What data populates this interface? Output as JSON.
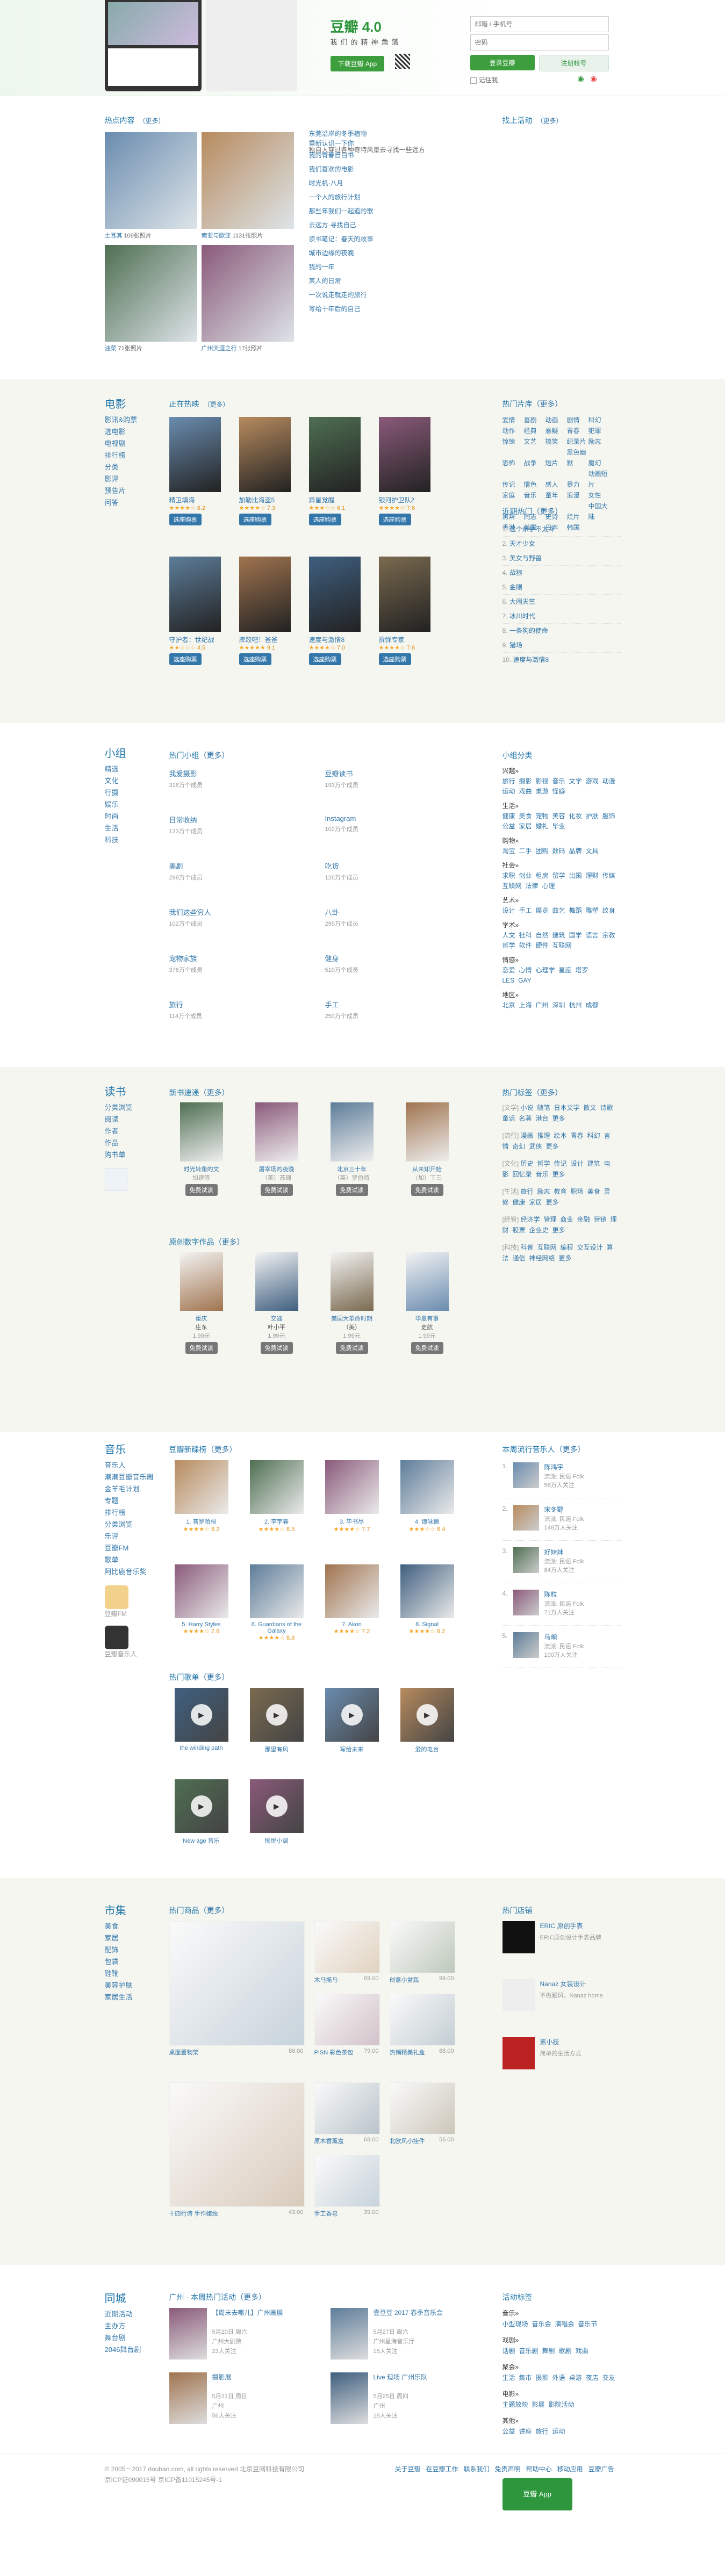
{
  "top": {
    "brand": "豆瓣 4.0",
    "tagline": "我们的精神角落",
    "download_btn": "下载豆瓣 App",
    "username_placeholder": "邮箱 / 手机号",
    "password_placeholder": "密码",
    "login_btn": "登录豆瓣",
    "register_btn": "注册帐号",
    "remember": "记住我",
    "forgot": "忘记密码"
  },
  "hot": {
    "title": "热点内容",
    "more": "（更多）",
    "photos": [
      {
        "caption": "土耳其",
        "count": "108张照片"
      },
      {
        "caption": "南亚与欧亚",
        "count": "1131张照片"
      },
      {
        "caption": "油菜",
        "count": "71张照片"
      },
      {
        "caption": "广州天涯之行",
        "count": "17张照片"
      }
    ],
    "articles": [
      "东莞沿岸的冬季植物",
      "重新认识一下你",
      "我的青春自白书",
      "我们喜欢的电影",
      "时光机·八月",
      "一个人的旅行计划",
      "那些年我们一起追的歌",
      "去远方·寻找自己",
      "读书笔记：春天的故事",
      "城市边缘的夜晚",
      "我的一年",
      "某人的日常",
      "一次说走就走的旅行",
      "写给十年后的自己"
    ],
    "intro": "独自人穿过各种奇特风景去寻找一些远方",
    "right_title": "找上活动",
    "right_more": "（更多）"
  },
  "movie": {
    "title": "电影",
    "nav": [
      "影讯&购票",
      "选电影",
      "电视剧",
      "排行榜",
      "分类",
      "影评",
      "预告片",
      "问答"
    ],
    "now_playing": "正在热映",
    "more": "（更多）",
    "buy_btn": "选座购票",
    "row1": [
      {
        "name": "精卫填海",
        "score": "8.2"
      },
      {
        "name": "加勒比海盗5",
        "score": "7.3"
      },
      {
        "name": "异星觉醒",
        "score": "6.1"
      },
      {
        "name": "银河护卫队2",
        "score": "7.6"
      }
    ],
    "row2": [
      {
        "name": "守护者：世纪战",
        "score": "4.5"
      },
      {
        "name": "摔跤吧！爸爸",
        "score": "9.1"
      },
      {
        "name": "速度与激情8",
        "score": "7.0"
      },
      {
        "name": "拆弹专家",
        "score": "7.8"
      }
    ],
    "tags_title": "热门片库",
    "tags_more": "（更多）",
    "tags": [
      "爱情",
      "喜剧",
      "动画",
      "剧情",
      "科幻",
      "动作",
      "经典",
      "悬疑",
      "青春",
      "犯罪",
      "惊悚",
      "文艺",
      "搞笑",
      "纪录片",
      "励志",
      "恐怖",
      "战争",
      "短片",
      "黑色幽默",
      "魔幻",
      "传记",
      "情色",
      "感人",
      "暴力",
      "动画短片",
      "家庭",
      "音乐",
      "童年",
      "浪漫",
      "女性",
      "黑帮",
      "同志",
      "史诗",
      "烂片",
      "中国大陆",
      "香港",
      "美国",
      "日本",
      "韩国"
    ],
    "rank_title": "近期热门",
    "rank_more": "（更多）",
    "rank": [
      "这个杀手不太冷",
      "天才少女",
      "美女与野兽",
      "战狼",
      "金刚",
      "大闹天竺",
      "冰川时代",
      "一条狗的使命",
      "猎场",
      "速度与激情8"
    ]
  },
  "group": {
    "title": "小组",
    "nav": [
      "精选",
      "文化",
      "行摄",
      "娱乐",
      "时尚",
      "生活",
      "科技"
    ],
    "hot_title": "热门小组",
    "more": "（更多）",
    "items": [
      {
        "name": "我爱摄影",
        "count": "316万个成员"
      },
      {
        "name": "豆瓣读书",
        "count": "193万个成员"
      },
      {
        "name": "日常收纳",
        "count": "123万个成员"
      },
      {
        "name": "Instagram",
        "count": "102万个成员"
      },
      {
        "name": "美剧",
        "count": "298万个成员"
      },
      {
        "name": "吃货",
        "count": "126万个成员"
      },
      {
        "name": "我们这些穷人",
        "count": "102万个成员"
      },
      {
        "name": "八卦",
        "count": "295万个成员"
      },
      {
        "name": "宠物家族",
        "count": "376万个成员"
      },
      {
        "name": "健身",
        "count": "510万个成员"
      },
      {
        "name": "旅行",
        "count": "114万个成员"
      },
      {
        "name": "手工",
        "count": "250万个成员"
      }
    ],
    "cat_title": "小组分类",
    "cats": [
      {
        "title": "兴趣»",
        "tags": [
          "旅行",
          "摄影",
          "影视",
          "音乐",
          "文学",
          "游戏",
          "动漫",
          "运动",
          "戏曲",
          "桌游",
          "怪癖"
        ]
      },
      {
        "title": "生活»",
        "tags": [
          "健康",
          "美食",
          "宠物",
          "美容",
          "化妆",
          "护肤",
          "服饰",
          "公益",
          "家居",
          "婚礼",
          "毕业"
        ]
      },
      {
        "title": "购物»",
        "tags": [
          "淘宝",
          "二手",
          "团购",
          "数码",
          "品牌",
          "文具"
        ]
      },
      {
        "title": "社会»",
        "tags": [
          "求职",
          "创业",
          "租房",
          "留学",
          "出国",
          "理财",
          "传媒",
          "互联网",
          "法律",
          "心理"
        ]
      },
      {
        "title": "艺术»",
        "tags": [
          "设计",
          "手工",
          "展览",
          "曲艺",
          "舞蹈",
          "雕塑",
          "纹身"
        ]
      },
      {
        "title": "学术»",
        "tags": [
          "人文",
          "社科",
          "自然",
          "建筑",
          "国学",
          "语言",
          "宗教",
          "哲学",
          "软件",
          "硬件",
          "互联网"
        ]
      },
      {
        "title": "情感»",
        "tags": [
          "恋爱",
          "心情",
          "心理学",
          "星座",
          "塔罗",
          "LES",
          "GAY"
        ]
      },
      {
        "title": "地区»",
        "tags": [
          "北京",
          "上海",
          "广州",
          "深圳",
          "杭州",
          "成都"
        ]
      }
    ]
  },
  "book": {
    "title": "读书",
    "nav": [
      "分类浏览",
      "阅读",
      "作者",
      "作品",
      "购书单"
    ],
    "new_title": "新书速递",
    "more": "（更多）",
    "new_books": [
      {
        "title": "时光转角的文",
        "sub": "加速等"
      },
      {
        "title": "屠宰场的夜晚",
        "sub": "（美）苏珊"
      },
      {
        "title": "北京三十年",
        "sub": "（英）罗伯特"
      },
      {
        "title": "从未知开始",
        "sub": "（加）丁三"
      }
    ],
    "trial_btn": "免费试读",
    "ebook_title": "原创数字作品",
    "ebooks": [
      {
        "title": "重庆",
        "author": "庄东",
        "price": "1.99元"
      },
      {
        "title": "交通",
        "author": "叶小平",
        "price": "1.99元"
      },
      {
        "title": "美国大革命时期",
        "author": "（美）",
        "price": "1.99元"
      },
      {
        "title": "华夏有事",
        "author": "史航",
        "price": "1.99元"
      }
    ],
    "tags_title": "热门标签",
    "tags_more": "（更多）",
    "tags": [
      {
        "title": "[文学]",
        "list": [
          "小说",
          "随笔",
          "日本文学",
          "散文",
          "诗歌",
          "童话",
          "名著",
          "港台",
          "更多"
        ]
      },
      {
        "title": "[流行]",
        "list": [
          "漫画",
          "推理",
          "绘本",
          "青春",
          "科幻",
          "言情",
          "奇幻",
          "武侠",
          "更多"
        ]
      },
      {
        "title": "[文化]",
        "list": [
          "历史",
          "哲学",
          "传记",
          "设计",
          "建筑",
          "电影",
          "回忆录",
          "音乐",
          "更多"
        ]
      },
      {
        "title": "[生活]",
        "list": [
          "旅行",
          "励志",
          "教育",
          "职场",
          "美食",
          "灵修",
          "健康",
          "家居",
          "更多"
        ]
      },
      {
        "title": "[经管]",
        "list": [
          "经济学",
          "管理",
          "商业",
          "金融",
          "营销",
          "理财",
          "股票",
          "企业史",
          "更多"
        ]
      },
      {
        "title": "[科技]",
        "list": [
          "科普",
          "互联网",
          "编程",
          "交互设计",
          "算法",
          "通信",
          "神经网络",
          "更多"
        ]
      }
    ]
  },
  "music": {
    "title": "音乐",
    "nav": [
      "音乐人",
      "潮潮豆瓣音乐周",
      "金羊毛计划",
      "专题",
      "排行榜",
      "分类浏览",
      "乐评",
      "豆瓣FM",
      "歌单",
      "阿比鹿音乐奖"
    ],
    "new_title": "豆瓣新碟榜",
    "more": "（更多）",
    "row1": [
      {
        "name": "1. 普罗哈根",
        "score": "8.2"
      },
      {
        "name": "2. 李宇春",
        "score": "8.5"
      },
      {
        "name": "3. 毕书尽",
        "score": "7.7"
      },
      {
        "name": "4. 谭咏麟",
        "score": "6.4"
      }
    ],
    "row2": [
      {
        "name": "5. Harry Styles",
        "score": "7.6"
      },
      {
        "name": "6. Guardians of the Galaxy",
        "score": "8.8"
      },
      {
        "name": "7. Akon",
        "score": "7.2"
      },
      {
        "name": "8. Signal",
        "score": "8.2"
      }
    ],
    "radio_title": "热门歌单",
    "radio": [
      "the winding path",
      "那里有风",
      "写给未来",
      "爱的电台",
      "New age 音乐",
      "愉悦小调"
    ],
    "fm_label": "豆瓣FM",
    "musician_label": "豆瓣音乐人",
    "week_title": "本周流行音乐人",
    "week_more": "（更多）",
    "week": [
      {
        "rank": "1.",
        "name": "陈鸿宇",
        "genre": "流派: 民谣 Folk",
        "fans": "56万人关注"
      },
      {
        "rank": "2.",
        "name": "宋冬野",
        "genre": "流派: 民谣 Folk",
        "fans": "148万人关注"
      },
      {
        "rank": "3.",
        "name": "好妹妹",
        "genre": "流派: 民谣 Folk",
        "fans": "84万人关注"
      },
      {
        "rank": "4.",
        "name": "陈粒",
        "genre": "流派: 民谣 Folk",
        "fans": "71万人关注"
      },
      {
        "rank": "5.",
        "name": "马頔",
        "genre": "流派: 民谣 Folk",
        "fans": "100万人关注"
      }
    ]
  },
  "market": {
    "title": "市集",
    "nav": [
      "美食",
      "家居",
      "配饰",
      "包袋",
      "鞋靴",
      "美容护肤",
      "家居生活"
    ],
    "hot_title": "热门商品",
    "more": "（更多）",
    "items": [
      {
        "name": "桌面置物架",
        "price": "86.00"
      },
      {
        "name": "木马摇马",
        "price": "69.00"
      },
      {
        "name": "创意小盆栽",
        "price": "99.00"
      },
      {
        "name": "PISN 彩色茶包",
        "price": "79.00"
      },
      {
        "name": "热销精美礼盒",
        "price": "88.00"
      },
      {
        "name": "十四行诗 手作蜡烛",
        "price": "43.00"
      },
      {
        "name": "原木香薰盒",
        "price": "68.00"
      },
      {
        "name": "北欧风小挂件",
        "price": "56.00"
      },
      {
        "name": "手工香皂",
        "price": "39.00"
      }
    ],
    "shops_title": "热门店铺",
    "shops": [
      {
        "name": "ERIC 原创手表",
        "desc": "ERIC原创设计手表品牌"
      },
      {
        "name": "Nanaz 女装设计",
        "desc": "不做跟风，Nanaz home"
      },
      {
        "name": "素小技",
        "desc": "简单的生活方式"
      }
    ]
  },
  "city": {
    "title": "同城",
    "nav": [
      "近期活动",
      "主办方",
      "舞台剧",
      "2046舞台剧"
    ],
    "hot_title": "广州 · 本周热门活动",
    "more": "（更多）",
    "events": [
      {
        "title": "【周末去哪儿】广州画展",
        "time": "5月20日 周六",
        "place": "广州大剧院",
        "join": "23人关注"
      },
      {
        "title": "壹豆豆 2017 春季音乐会",
        "time": "5月27日 周六",
        "place": "广州星海音乐厅",
        "join": "15人关注"
      },
      {
        "title": "摄影展",
        "time": "5月21日 周日",
        "place": "广州",
        "join": "56人关注"
      },
      {
        "title": "Live 现场 广州乐队",
        "time": "5月25日 周四",
        "place": "广州",
        "join": "18人关注"
      }
    ],
    "cat_title": "活动标签",
    "cats": [
      {
        "title": "音乐»",
        "list": [
          "小型现场",
          "音乐会",
          "演唱会",
          "音乐节"
        ]
      },
      {
        "title": "戏剧»",
        "list": [
          "话剧",
          "音乐剧",
          "舞剧",
          "歌剧",
          "戏曲"
        ]
      },
      {
        "title": "聚会»",
        "list": [
          "生活",
          "集市",
          "摄影",
          "外语",
          "桌游",
          "夜店",
          "交友"
        ]
      },
      {
        "title": "电影»",
        "list": [
          "主题放映",
          "影展",
          "影院活动"
        ]
      },
      {
        "title": "其他»",
        "list": [
          "公益",
          "讲座",
          "旅行",
          "运动"
        ]
      }
    ]
  },
  "footer": {
    "copyright": "© 2005－2017 douban.com, all rights reserved 北京豆网科技有限公司",
    "icp": "京ICP证090015号 京ICP备11015245号-1",
    "links": [
      "关于豆瓣",
      "在豆瓣工作",
      "联系我们",
      "免责声明",
      "帮助中心",
      "移动应用",
      "豆瓣广告"
    ],
    "app_label": "豆瓣 App"
  }
}
